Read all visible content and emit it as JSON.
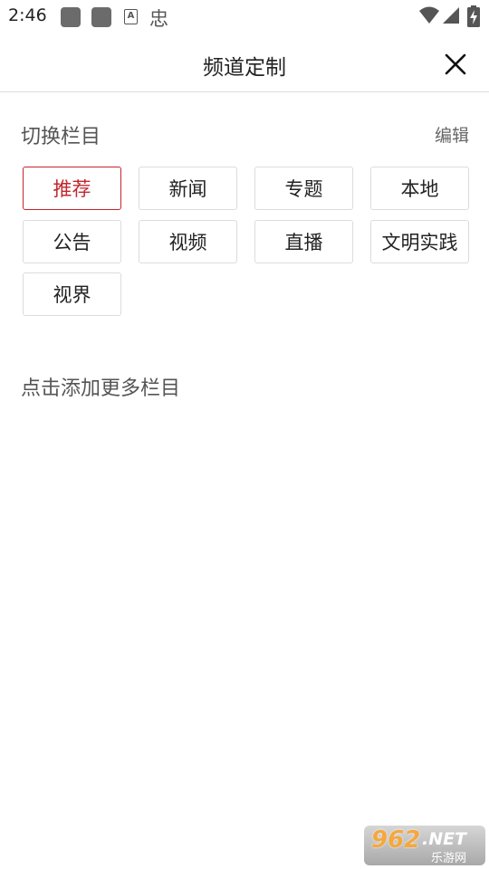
{
  "status_bar": {
    "time": "2:46",
    "left_icons": [
      "app-notification-icon",
      "app-notification-icon",
      "a-box-icon",
      "glyph-icon"
    ],
    "right_icons": [
      "wifi-icon",
      "signal-icon",
      "battery-charging-icon"
    ]
  },
  "header": {
    "title": "频道定制",
    "close_icon": "close-icon"
  },
  "my_channels": {
    "title": "切换栏目",
    "edit_label": "编辑",
    "items": [
      {
        "label": "推荐",
        "active": true
      },
      {
        "label": "新闻",
        "active": false
      },
      {
        "label": "专题",
        "active": false
      },
      {
        "label": "本地",
        "active": false
      },
      {
        "label": "公告",
        "active": false
      },
      {
        "label": "视频",
        "active": false
      },
      {
        "label": "直播",
        "active": false
      },
      {
        "label": "文明实践",
        "active": false
      },
      {
        "label": "视界",
        "active": false
      }
    ]
  },
  "more_channels": {
    "title": "点击添加更多栏目"
  },
  "watermark": {
    "main": "962",
    "net": ".NET",
    "sub": "乐游网"
  },
  "colors": {
    "accent": "#c1272d",
    "chip_border": "#dcdcdc",
    "divider": "#dddddd",
    "text": "#222222",
    "muted_text": "#555555"
  }
}
